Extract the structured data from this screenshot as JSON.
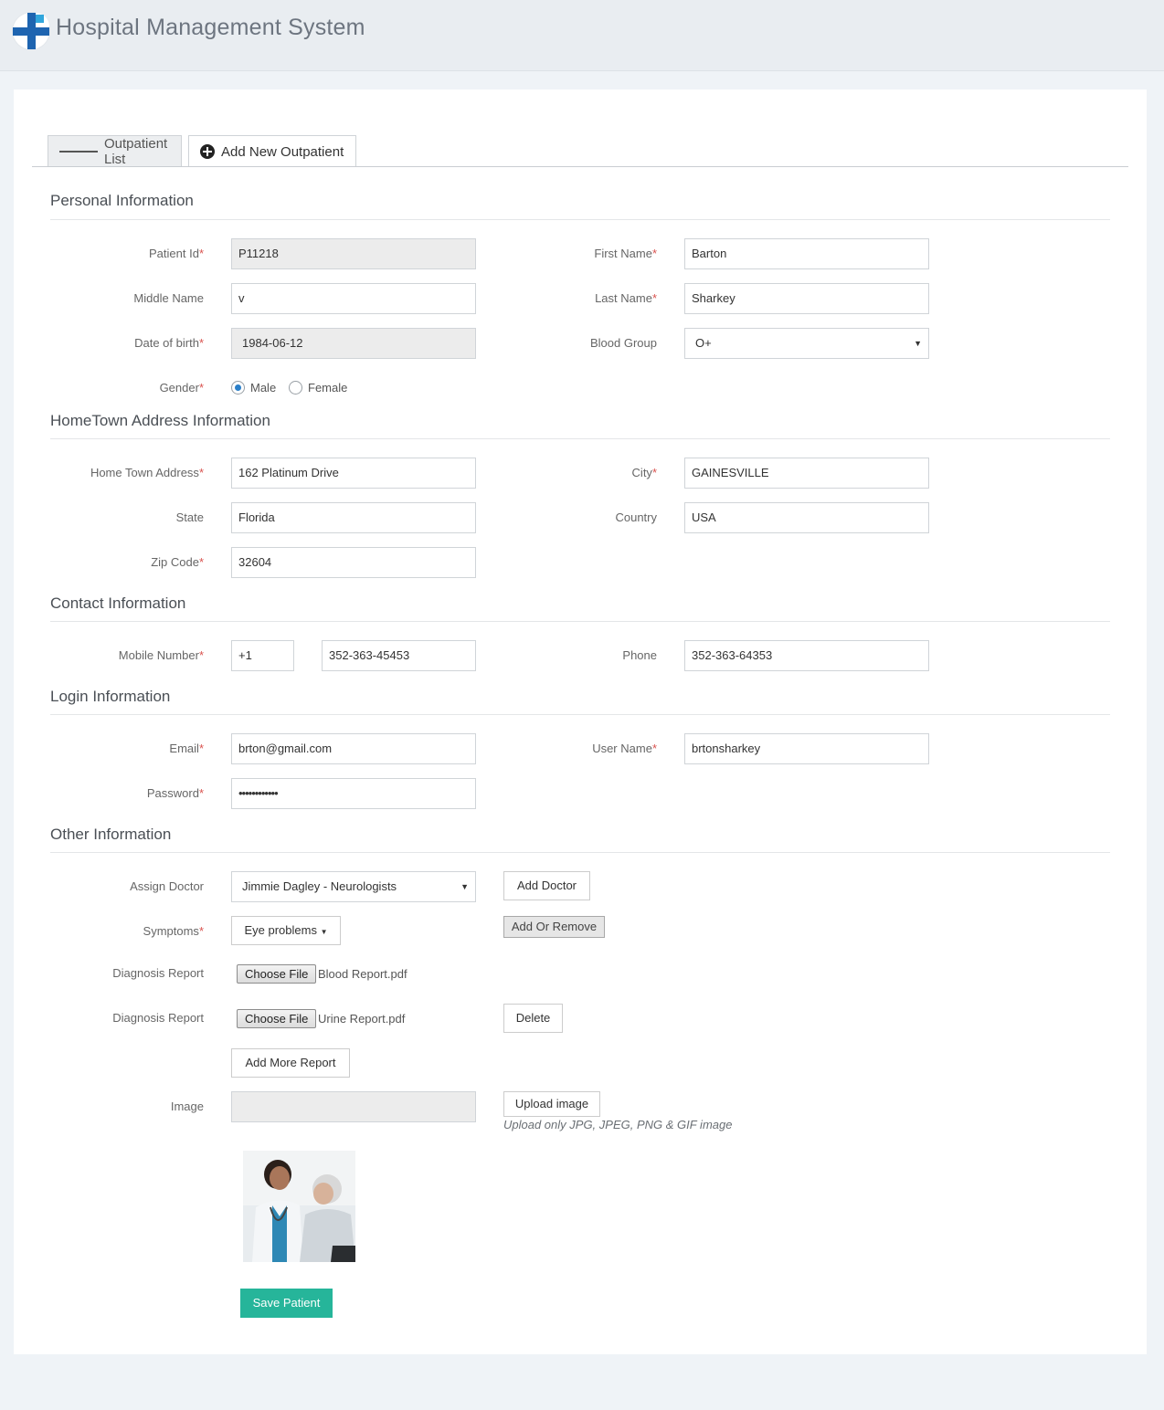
{
  "app": {
    "title": "Hospital Management System"
  },
  "tabs": [
    {
      "label": "Outpatient List",
      "icon": "list-icon"
    },
    {
      "label": "Add New Outpatient",
      "icon": "plus-circle-icon"
    }
  ],
  "sections": {
    "personal": "Personal Information",
    "hometown": "HomeTown Address Information",
    "contact": "Contact Information",
    "login": "Login Information",
    "other": "Other Information"
  },
  "personal": {
    "patient_id": {
      "label": "Patient Id",
      "value": "P11218"
    },
    "first_name": {
      "label": "First Name",
      "value": "Barton"
    },
    "middle_name": {
      "label": "Middle Name",
      "value": "v"
    },
    "last_name": {
      "label": "Last Name",
      "value": "Sharkey"
    },
    "dob": {
      "label": "Date of birth",
      "value": "1984-06-12"
    },
    "blood_group": {
      "label": "Blood Group",
      "value": "O+"
    },
    "gender": {
      "label": "Gender",
      "options": [
        "Male",
        "Female"
      ],
      "selected": "Male"
    }
  },
  "hometown": {
    "address": {
      "label": "Home Town Address",
      "value": "162  Platinum Drive"
    },
    "city": {
      "label": "City",
      "value": "GAINESVILLE"
    },
    "state": {
      "label": "State",
      "value": "Florida"
    },
    "country": {
      "label": "Country",
      "value": "USA"
    },
    "zip": {
      "label": "Zip Code",
      "value": "32604"
    }
  },
  "contact": {
    "mobile": {
      "label": "Mobile Number",
      "code": "+1",
      "value": "352-363-45453"
    },
    "phone": {
      "label": "Phone",
      "value": "352-363-64353"
    }
  },
  "login": {
    "email": {
      "label": "Email",
      "value": "brton@gmail.com"
    },
    "username": {
      "label": "User Name",
      "value": "brtonsharkey"
    },
    "password": {
      "label": "Password",
      "value": "••••••••••••"
    }
  },
  "other": {
    "assign_doctor": {
      "label": "Assign Doctor",
      "value": "Jimmie Dagley - Neurologists",
      "button": "Add Doctor"
    },
    "symptoms": {
      "label": "Symptoms",
      "value": "Eye problems",
      "button": "Add Or Remove"
    },
    "reports": [
      {
        "label": "Diagnosis Report",
        "file_button": "Choose File",
        "file": "Blood Report.pdf"
      },
      {
        "label": "Diagnosis Report",
        "file_button": "Choose File",
        "file": "Urine Report.pdf",
        "delete": "Delete"
      }
    ],
    "add_more": "Add More Report",
    "image": {
      "label": "Image",
      "value": "",
      "button": "Upload image",
      "hint": "Upload only JPG, JPEG, PNG & GIF image"
    }
  },
  "save_button": "Save Patient",
  "colors": {
    "accent": "#26b59a",
    "brand": "#1e64b0",
    "required": "#d9534f"
  }
}
